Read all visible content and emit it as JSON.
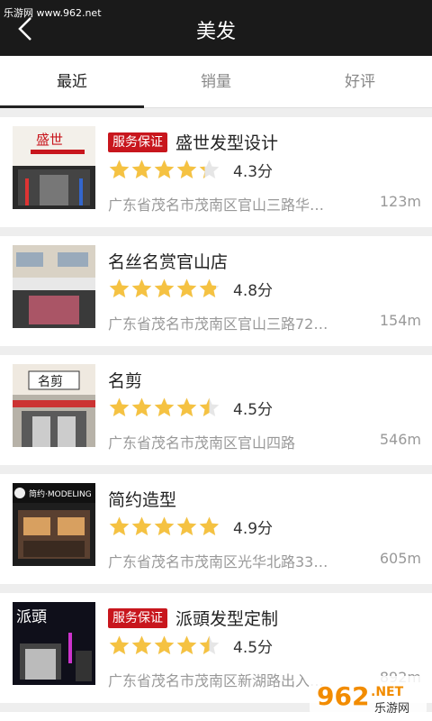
{
  "watermark": "乐游网 www.962.net",
  "header": {
    "title": "美发",
    "back_icon": "chevron-left-icon"
  },
  "tabs": [
    {
      "label": "最近",
      "active": true
    },
    {
      "label": "销量",
      "active": false
    },
    {
      "label": "好评",
      "active": false
    }
  ],
  "shops": [
    {
      "badge": "服务保证",
      "name": "盛世发型设计",
      "rating": 4.3,
      "score": "4.3分",
      "address": "广东省茂名市茂南区官山三路华…",
      "distance": "123m",
      "sign": "盛世"
    },
    {
      "badge": "",
      "name": "名丝名赏官山店",
      "rating": 4.8,
      "score": "4.8分",
      "address": "广东省茂名市茂南区官山三路72…",
      "distance": "154m",
      "sign": ""
    },
    {
      "badge": "",
      "name": "名剪",
      "rating": 4.5,
      "score": "4.5分",
      "address": "广东省茂名市茂南区官山四路",
      "distance": "546m",
      "sign": "名剪"
    },
    {
      "badge": "",
      "name": "简约造型",
      "rating": 4.9,
      "score": "4.9分",
      "address": "广东省茂名市茂南区光华北路33…",
      "distance": "605m",
      "sign": "简约·MODELING"
    },
    {
      "badge": "服务保证",
      "name": "派頭发型定制",
      "rating": 4.5,
      "score": "4.5分",
      "address": "广东省茂名市茂南区新湖路出入…",
      "distance": "892m",
      "sign": "派頭"
    }
  ],
  "brand_logo": {
    "top": "962",
    "sub": ".NET",
    "caption": "乐游网"
  },
  "colors": {
    "header_bg": "#1a1a1a",
    "badge_bg": "#c8161d",
    "star": "#f5c242",
    "star_empty": "#e6e6e6"
  }
}
